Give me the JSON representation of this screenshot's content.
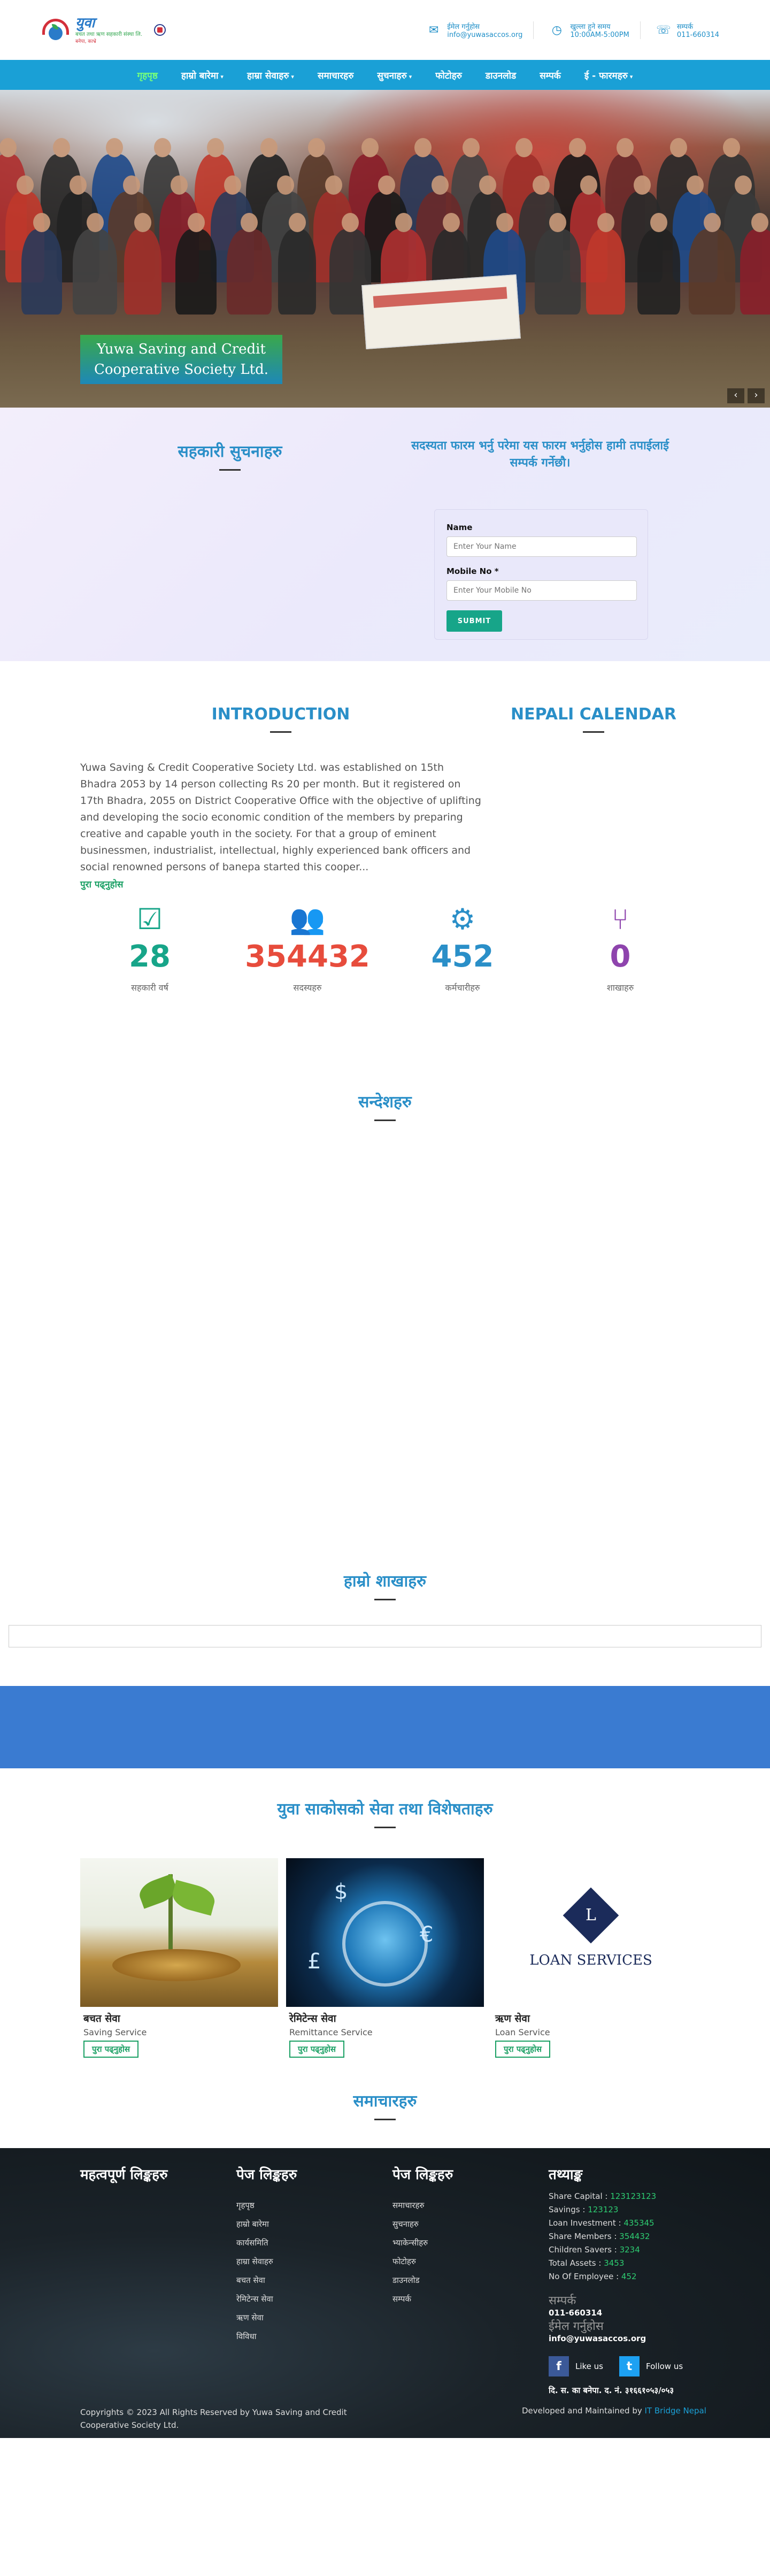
{
  "header": {
    "logo": {
      "brand": "युवा",
      "tagline": "बचत तथा ऋण सहकारी संस्था लि.",
      "tagline2": "बनेपा, काभ्रे"
    },
    "contacts": [
      {
        "icon": "email-icon",
        "label": "ईमेल गर्नुहोस",
        "value": "info@yuwasaccos.org"
      },
      {
        "icon": "clock-icon",
        "label": "खुल्ला हुने समय",
        "value": "10:00AM-5:00PM"
      },
      {
        "icon": "phone-icon",
        "label": "सम्पर्क",
        "value": "011-660314"
      }
    ]
  },
  "nav": {
    "items": [
      {
        "label": "गृहपृष्ठ",
        "active": true,
        "dropdown": false
      },
      {
        "label": "हाम्रो बारेमा",
        "active": false,
        "dropdown": true
      },
      {
        "label": "हाम्रा सेवाहरु",
        "active": false,
        "dropdown": true
      },
      {
        "label": "समाचारहरु",
        "active": false,
        "dropdown": false
      },
      {
        "label": "सुचनाहरु",
        "active": false,
        "dropdown": true
      },
      {
        "label": "फोटोहरु",
        "active": false,
        "dropdown": false
      },
      {
        "label": "डाउनलोड",
        "active": false,
        "dropdown": false
      },
      {
        "label": "सम्पर्क",
        "active": false,
        "dropdown": false
      },
      {
        "label": "ई - फारमहरु",
        "active": false,
        "dropdown": true
      }
    ]
  },
  "hero": {
    "caption": "Yuwa Saving and Credit Cooperative Society Ltd.",
    "prev": "‹",
    "next": "›"
  },
  "notice": {
    "title": "सहकारी सुचनाहरु",
    "form_title": "सदस्यता फारम भर्नु परेमा यस फारम भर्नुहोस हामी तपाईलाई सम्पर्क गर्नेछौ।",
    "name_label": "Name",
    "name_placeholder": "Enter Your Name",
    "mobile_label": "Mobile No *",
    "mobile_placeholder": "Enter Your Mobile No",
    "submit_label": "SUBMIT"
  },
  "intro": {
    "title": "INTRODUCTION",
    "text": "Yuwa Saving & Credit Cooperative Society Ltd. was established on 15th Bhadra 2053 by 14 person collecting Rs 20 per month. But it registered on 17th Bhadra, 2055 on District Cooperative Office with the objective of uplifting and developing the socio economic condition of the members by preparing creative and capable youth in the society. For that a group of eminent businessmen, industrialist, intellectual, highly experienced bank officers and social renowned persons of banepa started this cooper...",
    "read_more": "पुरा पढ्नुहोस",
    "calendar_title": "NEPALI CALENDAR"
  },
  "stats": [
    {
      "icon": "calendar-check-icon",
      "value": "28",
      "label": "सहकारी वर्ष",
      "color": "#17a589"
    },
    {
      "icon": "users-icon",
      "value": "354432",
      "label": "सदस्यहरु",
      "color": "#e74c3c"
    },
    {
      "icon": "users-cog-icon",
      "value": "452",
      "label": "कर्मचारीहरु",
      "color": "#2a8fc8"
    },
    {
      "icon": "code-branch-icon",
      "value": "0",
      "label": "शाखाहरु",
      "color": "#8e44ad"
    }
  ],
  "messages": {
    "title": "सन्देशहरु"
  },
  "branches": {
    "title": "हाम्रो शाखाहरु"
  },
  "services": {
    "title": "युवा साकोसको सेवा तथा विशेषताहरु",
    "items": [
      {
        "name": "बचत सेवा",
        "sub": "Saving Service",
        "button": "पुरा पढ्नुहोस"
      },
      {
        "name": "रेमिटेन्स सेवा",
        "sub": "Remittance Service",
        "button": "पुरा पढ्नुहोस"
      },
      {
        "name": "ऋण सेवा",
        "sub": "Loan Service",
        "button": "पुरा पढ्नुहोस",
        "image_text": "LOAN SERVICES"
      }
    ]
  },
  "news": {
    "title": "समाचारहरु"
  },
  "footer": {
    "important_links": {
      "title": "महत्वपूर्ण लिङ्कहरु"
    },
    "page_links_1": {
      "title": "पेज लिङ्कहरु",
      "items": [
        "गृहपृष्ठ",
        "हाम्रो बारेमा",
        "कार्यसमिति",
        "हाम्रा सेवाहरु",
        "बचत सेवा",
        "रेमिटेन्स सेवा",
        "ऋण सेवा",
        "विविधा"
      ]
    },
    "page_links_2": {
      "title": "पेज लिङ्कहरु",
      "items": [
        "समाचारहरु",
        "सुचनाहरु",
        "भ्याकेन्सीहरु",
        "फोटोहरु",
        "डाउनलोड",
        "सम्पर्क"
      ]
    },
    "facts": {
      "title": "तथ्याङ्क",
      "rows": [
        {
          "label": "Share Capital :",
          "value": "123123123"
        },
        {
          "label": "Savings :",
          "value": "123123"
        },
        {
          "label": "Loan Investment :",
          "value": "435345"
        },
        {
          "label": "Share Members :",
          "value": "354432"
        },
        {
          "label": "Children Savers :",
          "value": "3234"
        },
        {
          "label": "Total Assets :",
          "value": "3453"
        },
        {
          "label": "No Of Employee :",
          "value": "452"
        }
      ]
    },
    "contact": {
      "phone_label": "सम्पर्क",
      "phone": "011-660314",
      "email_label": "ईमेल गर्नुहोस",
      "email": "info@yuwasaccos.org"
    },
    "social": [
      {
        "icon": "facebook-icon",
        "label": "Like us",
        "glyph": "f",
        "color": "#3b5998"
      },
      {
        "icon": "twitter-icon",
        "label": "Follow us",
        "glyph": "t",
        "color": "#1da1f2"
      }
    ],
    "registration": "दि. स. का बनेपा. द. नं. ३१६६१०५३/०५३",
    "copyright": "Copyrights © 2023 All Rights Reserved by Yuwa Saving and Credit Cooperative Society Ltd.",
    "developed_by_prefix": "Developed and Maintained by",
    "developer": "IT Bridge Nepal"
  }
}
